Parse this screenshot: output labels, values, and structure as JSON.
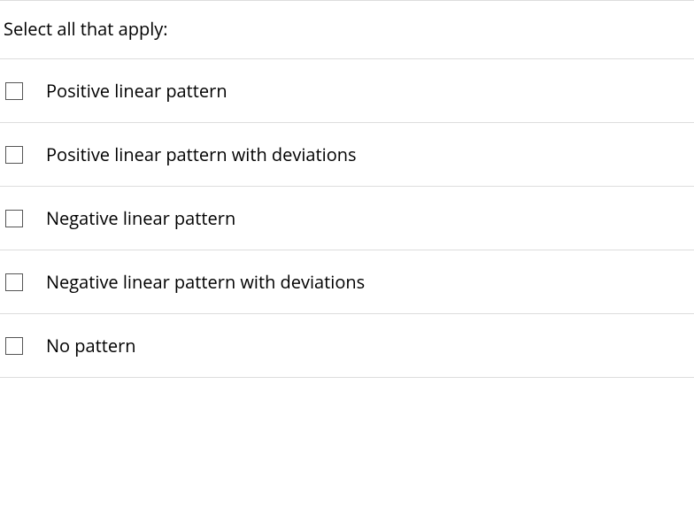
{
  "question": {
    "prompt": "Select all that apply:",
    "options": [
      {
        "label": "Positive linear pattern",
        "checked": false
      },
      {
        "label": "Positive linear pattern with deviations",
        "checked": false
      },
      {
        "label": "Negative linear pattern",
        "checked": false
      },
      {
        "label": "Negative linear pattern with deviations",
        "checked": false
      },
      {
        "label": "No pattern",
        "checked": false
      }
    ]
  }
}
